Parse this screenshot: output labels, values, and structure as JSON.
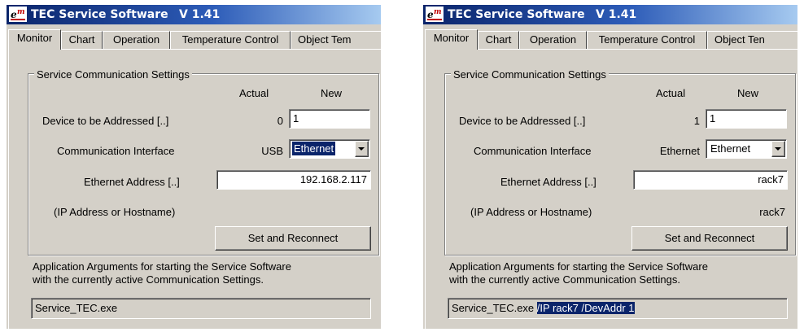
{
  "colors": {
    "title_start": "#0a246a",
    "title_end": "#a6caf0",
    "face": "#d4d0c8",
    "selection": "#0a246a"
  },
  "left": {
    "window": {
      "icon": "em-logo-icon",
      "title": "TEC Service Software",
      "version": "V 1.41"
    },
    "tabs": [
      "Monitor",
      "Chart",
      "Operation",
      "Temperature Control",
      "Object Tem"
    ],
    "group_title": "Service Communication Settings",
    "col_actual": "Actual",
    "col_new": "New",
    "device_label": "Device to be Addressed [..]",
    "device_actual": "0",
    "device_new": "1",
    "interface_label": "Communication Interface",
    "interface_actual": "USB",
    "interface_new": "Ethernet",
    "eth_label": "Ethernet Address [..]",
    "eth_new": "192.168.2.117",
    "ip_label": "(IP Address or Hostname)",
    "ip_actual": "",
    "set_button": "Set and Reconnect",
    "args_line1": "Application Arguments for starting the Service Software",
    "args_line2": "with the currently active Communication Settings.",
    "args_exe": "Service_TEC.exe",
    "args_params": ""
  },
  "right": {
    "window": {
      "icon": "em-logo-icon",
      "title": "TEC Service Software",
      "version": "V 1.41"
    },
    "tabs": [
      "Monitor",
      "Chart",
      "Operation",
      "Temperature Control",
      "Object Ten"
    ],
    "group_title": "Service Communication Settings",
    "col_actual": "Actual",
    "col_new": "New",
    "device_label": "Device to be Addressed [..]",
    "device_actual": "1",
    "device_new": "1",
    "interface_label": "Communication Interface",
    "interface_actual": "Ethernet",
    "interface_new": "Ethernet",
    "eth_label": "Ethernet Address [..]",
    "eth_new": "rack7",
    "ip_label": "(IP Address or Hostname)",
    "ip_actual": "rack7",
    "set_button": "Set and Reconnect",
    "args_line1": "Application Arguments for starting the Service Software",
    "args_line2": "with the currently active Communication Settings.",
    "args_exe": "Service_TEC.exe",
    "args_params": "/IP rack7 /DevAddr 1"
  }
}
